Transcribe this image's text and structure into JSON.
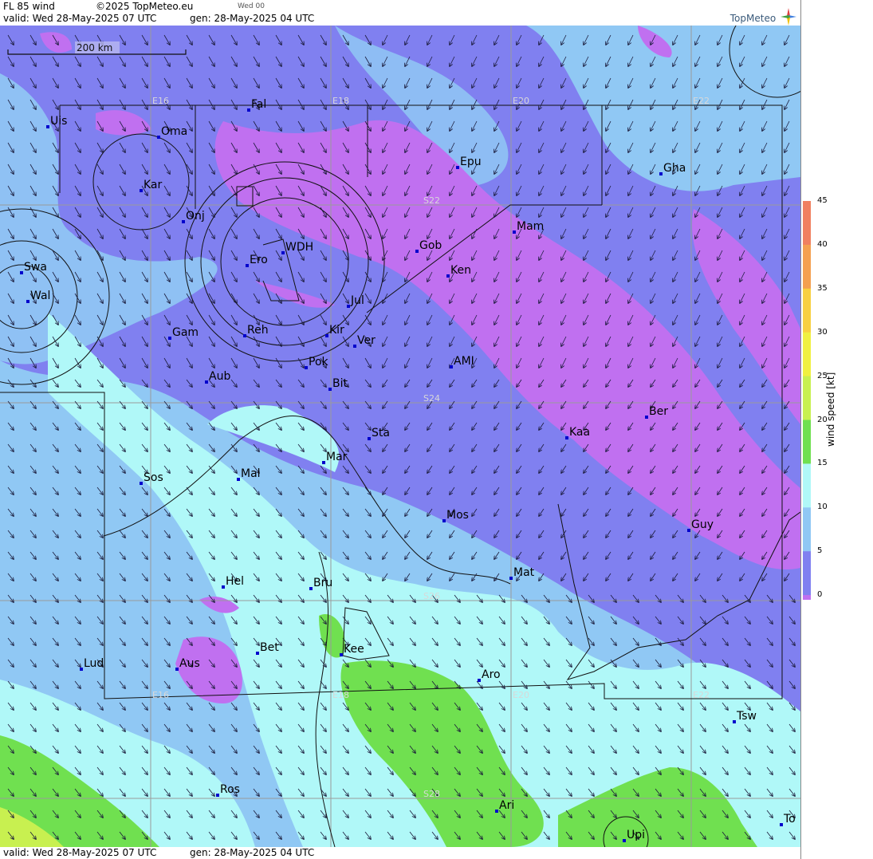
{
  "header": {
    "product": "FL 85 wind",
    "copyright": "©2025 TopMeteo.eu",
    "day_tag": "Wed 00",
    "valid": "valid:  Wed  28-May-2025  07 UTC",
    "generated": "gen:  28-May-2025  04 UTC",
    "brand": "TopMeteo"
  },
  "footer": {
    "valid": "valid:  Wed  28-May-2025  07 UTC",
    "generated": "gen:  28-May-2025  04 UTC"
  },
  "scale_bar": {
    "label": "200 km"
  },
  "grid_labels": {
    "longitudes": [
      "E16",
      "E18",
      "E20",
      "E22"
    ],
    "latitudes": [
      "S22",
      "S24",
      "S26",
      "S28"
    ]
  },
  "places": [
    "Uis",
    "Fal",
    "Oma",
    "Kar",
    "Onj",
    "Epu",
    "Gha",
    "Swa",
    "Wal",
    "Ero",
    "WDH",
    "Gob",
    "Mam",
    "Ken",
    "Jul",
    "Gam",
    "Reh",
    "Kir",
    "Ver",
    "Pok",
    "AMI",
    "Aub",
    "Bit",
    "Sta",
    "Ber",
    "Kaa",
    "Mar",
    "Sos",
    "Mal",
    "Mos",
    "Guy",
    "Hel",
    "Bru",
    "Mat",
    "Kee",
    "Bet",
    "Lud",
    "Aus",
    "Aro",
    "Tsw",
    "Ros",
    "Ari",
    "To",
    "Upi"
  ],
  "legend": {
    "title": "wind  speed  [kt]",
    "ticks": [
      "45",
      "40",
      "35",
      "30",
      "25",
      "20",
      "15",
      "10",
      "5",
      "0"
    ],
    "colors": [
      "#f08060",
      "#f4a050",
      "#f8d040",
      "#f0f040",
      "#c8f050",
      "#70e050",
      "#b0f8f8",
      "#90c8f4",
      "#8080f0",
      "#c070f0"
    ]
  }
}
